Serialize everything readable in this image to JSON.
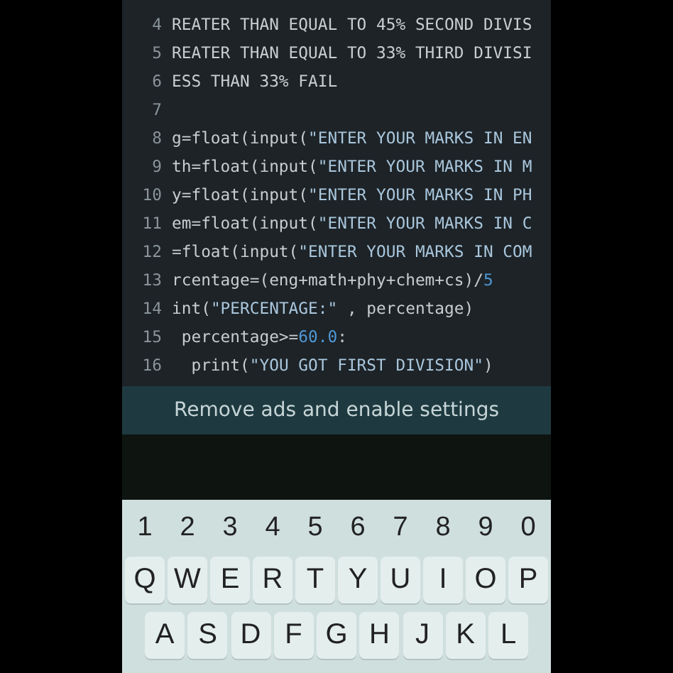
{
  "editor": {
    "lines": [
      {
        "number": "4",
        "tokens": [
          {
            "kind": "plain",
            "text": "REATER THAN EQUAL TO 45% SECOND DIVIS"
          }
        ]
      },
      {
        "number": "5",
        "tokens": [
          {
            "kind": "plain",
            "text": "REATER THAN EQUAL TO 33% THIRD DIVISI"
          }
        ]
      },
      {
        "number": "6",
        "tokens": [
          {
            "kind": "plain",
            "text": "ESS THAN 33% FAIL"
          }
        ]
      },
      {
        "number": "7"
      },
      {
        "number": "8",
        "tokens": [
          {
            "kind": "plain",
            "text": "g=float(input("
          },
          {
            "kind": "string",
            "text": "\"ENTER YOUR MARKS IN EN"
          }
        ]
      },
      {
        "number": "9",
        "tokens": [
          {
            "kind": "plain",
            "text": "th=float(input("
          },
          {
            "kind": "string",
            "text": "\"ENTER YOUR MARKS IN M"
          }
        ]
      },
      {
        "number": "10",
        "tokens": [
          {
            "kind": "plain",
            "text": "y=float(input("
          },
          {
            "kind": "string",
            "text": "\"ENTER YOUR MARKS IN PH"
          }
        ]
      },
      {
        "number": "11",
        "tokens": [
          {
            "kind": "plain",
            "text": "em=float(input("
          },
          {
            "kind": "string",
            "text": "\"ENTER YOUR MARKS IN C"
          }
        ]
      },
      {
        "number": "12",
        "tokens": [
          {
            "kind": "plain",
            "text": "=float(input("
          },
          {
            "kind": "string",
            "text": "\"ENTER YOUR MARKS IN COM"
          }
        ]
      },
      {
        "number": "13",
        "tokens": [
          {
            "kind": "plain",
            "text": "rcentage=(eng+math+phy+chem+cs)/"
          },
          {
            "kind": "number",
            "text": "5"
          }
        ]
      },
      {
        "number": "14",
        "tokens": [
          {
            "kind": "plain",
            "text": "int("
          },
          {
            "kind": "string",
            "text": "\"PERCENTAGE:\""
          },
          {
            "kind": "plain",
            "text": " , percentage)"
          }
        ]
      },
      {
        "number": "15",
        "tokens": [
          {
            "kind": "plain",
            "text": " percentage>="
          },
          {
            "kind": "number",
            "text": "60.0"
          },
          {
            "kind": "plain",
            "text": ":"
          }
        ]
      },
      {
        "number": "16",
        "tokens": [
          {
            "kind": "plain",
            "text": "  print("
          },
          {
            "kind": "string",
            "text": "\"YOU GOT FIRST DIVISION\""
          },
          {
            "kind": "plain",
            "text": ")"
          }
        ]
      }
    ]
  },
  "ad_banner": {
    "label": "Remove ads and enable settings"
  },
  "keyboard": {
    "rows": [
      {
        "kind": "digits",
        "keys": [
          "1",
          "2",
          "3",
          "4",
          "5",
          "6",
          "7",
          "8",
          "9",
          "0"
        ]
      },
      {
        "kind": "letters",
        "keys": [
          "Q",
          "W",
          "E",
          "R",
          "T",
          "Y",
          "U",
          "I",
          "O",
          "P"
        ]
      },
      {
        "kind": "letters",
        "keys": [
          "A",
          "S",
          "D",
          "F",
          "G",
          "H",
          "J",
          "K",
          "L"
        ]
      }
    ]
  }
}
